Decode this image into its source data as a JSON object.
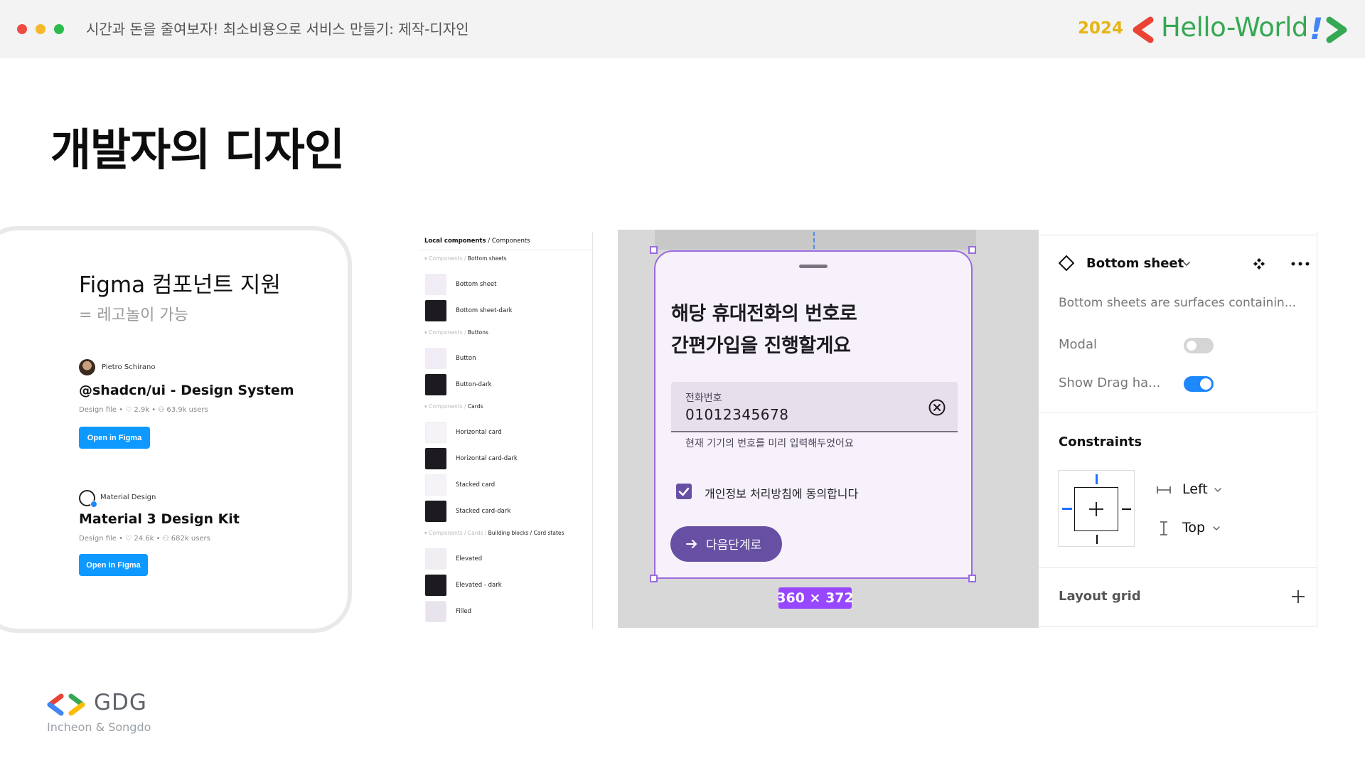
{
  "header": {
    "title": "시간과 돈을 줄여보자! 최소비용으로 서비스 만들기: 제작-디자인",
    "brand_year": "2024",
    "brand_name": "Hello-World",
    "brand_mark": "!",
    "brand_colors": {
      "year": "#e6b416",
      "name": "#36a853",
      "left_chevron": "#ea4335",
      "right_chevron": "#34a853",
      "exclamation": "#4285f4"
    }
  },
  "page_title": "개발자의 디자인",
  "figma_card": {
    "title": "Figma 컴포넌트 지원",
    "subtitle": "= 레고놀이 가능",
    "kits": [
      {
        "author": "Pietro Schirano",
        "name": "@shadcn/ui - Design System",
        "meta": "Design file • ♡ 2.9k • ⚇ 63.9k users",
        "button": "Open in Figma"
      },
      {
        "author": "Material Design",
        "name": "Material 3 Design Kit",
        "meta": "Design file • ♡ 24.6k • ⚇ 682k users",
        "button": "Open in Figma"
      }
    ],
    "button_color": "#0d99ff"
  },
  "components_panel": {
    "heading_bold": "Local components",
    "heading_rest": "/  Components",
    "sections": [
      {
        "path": "▾ Components / ",
        "name": "Bottom sheets",
        "items": [
          {
            "label": "Bottom sheet",
            "thumb": "#f1ecf6"
          },
          {
            "label": "Bottom sheet-dark",
            "thumb": "#1d1b20"
          }
        ]
      },
      {
        "path": "▾ Components / ",
        "name": "Buttons",
        "items": [
          {
            "label": "Button",
            "thumb": "#f1ecf6"
          },
          {
            "label": "Button-dark",
            "thumb": "#1d1b20"
          }
        ]
      },
      {
        "path": "▾ Components / ",
        "name": "Cards",
        "items": [
          {
            "label": "Horizontal card",
            "thumb": "#f5f2f8"
          },
          {
            "label": "Horizontal card-dark",
            "thumb": "#1d1b20"
          },
          {
            "label": "Stacked card",
            "thumb": "#f5f2f8"
          },
          {
            "label": "Stacked card-dark",
            "thumb": "#1d1b20"
          }
        ]
      },
      {
        "path": "▾ Components / Cards / ",
        "name": "Building blocks / Card states",
        "items": [
          {
            "label": "Elevated",
            "thumb": "#f1eef3"
          },
          {
            "label": "Elevated - dark",
            "thumb": "#1d1b20"
          },
          {
            "label": "Filled",
            "thumb": "#e8e3ec"
          }
        ]
      }
    ]
  },
  "bottom_sheet_preview": {
    "title_line1": "해당 휴대전화의 번호로",
    "title_line2": "간편가입을 진행할게요",
    "field_label": "전화번호",
    "field_value": "01012345678",
    "field_help": "현재 기기의 번호를 미리 입력해두었어요",
    "consent_label": "개인정보 처리방침에 동의합니다",
    "consent_checked": true,
    "next_button": "다음단계로",
    "size_badge": "360 × 372",
    "accent": "#6750a4",
    "selection_color": "#9a6be0"
  },
  "properties": {
    "component_name": "Bottom sheet",
    "description": "Bottom sheets are surfaces containin...",
    "props": [
      {
        "label": "Modal",
        "on": false
      },
      {
        "label": "Show Drag ha...",
        "on": true
      }
    ],
    "constraints_title": "Constraints",
    "horizontal": "Left",
    "vertical": "Top",
    "layout_grid_title": "Layout grid",
    "toggle_on_color": "#1e88ff"
  },
  "footer": {
    "logo_text": "GDG",
    "location": "Incheon & Songdo"
  }
}
